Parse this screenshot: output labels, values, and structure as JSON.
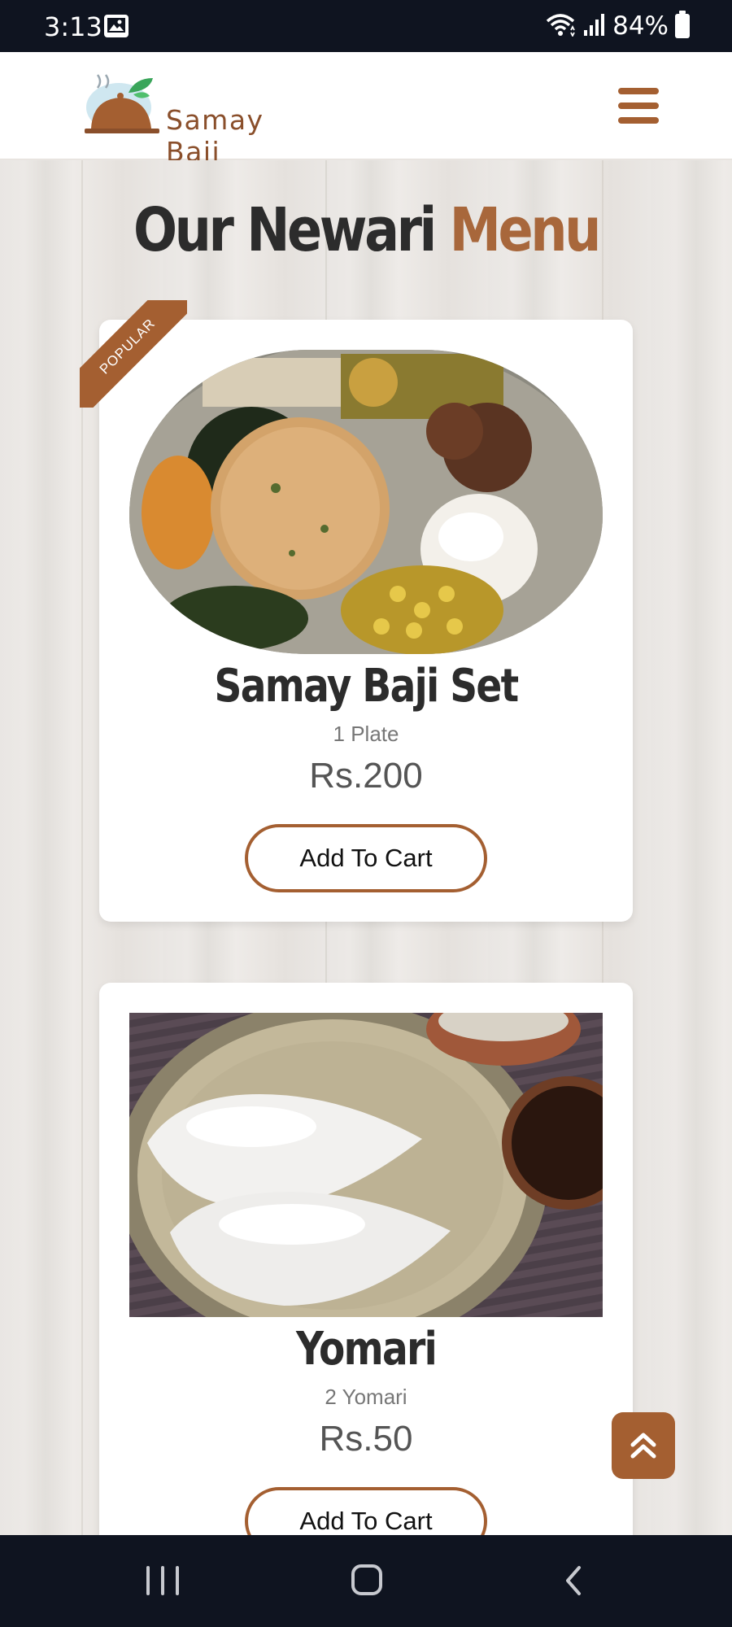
{
  "status_bar": {
    "time": "3:13",
    "battery": "84%",
    "icons": [
      "gallery-icon",
      "wifi-icon",
      "signal-icon",
      "battery-icon"
    ]
  },
  "header": {
    "brand": "Samay Baji",
    "logo_icon": "cloche-icon",
    "menu_icon": "hamburger-icon"
  },
  "page": {
    "heading_main": "Our Newari",
    "heading_accent": "Menu"
  },
  "menu_items": [
    {
      "badge": "POPULAR",
      "name": "Samay Baji Set",
      "quantity": "1 Plate",
      "price": "Rs.200",
      "button": "Add To Cart"
    },
    {
      "name": "Yomari",
      "quantity": "2 Yomari",
      "price": "Rs.50",
      "button": "Add To Cart"
    }
  ],
  "colors": {
    "accent": "#a45f31",
    "heading_accent": "#a8673b",
    "status_bar": "#0f1420"
  },
  "controls": {
    "scroll_top_icon": "double-chevron-up-icon",
    "nav": [
      "recent-apps-icon",
      "home-icon",
      "back-icon"
    ]
  }
}
